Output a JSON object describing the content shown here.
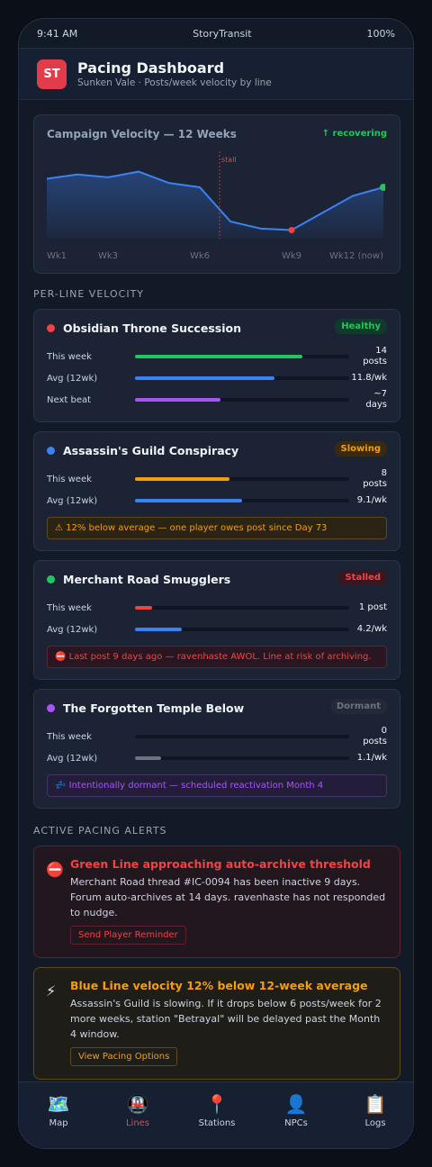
{
  "status_bar": {
    "time": "9:41 AM",
    "app_name": "StoryTransit",
    "battery": "100%"
  },
  "header": {
    "logo": "ST",
    "title": "Pacing Dashboard",
    "subtitle": "Sunken Vale · Posts/week velocity by line",
    "logo_color": "#e23b4a"
  },
  "velocity_chart": {
    "title": "Campaign Velocity — 12 Weeks",
    "status": "↑ recovering",
    "stall_label": "stall",
    "x_labels": [
      "Wk1",
      "Wk3",
      "Wk6",
      "Wk9",
      "Wk12 (now)"
    ]
  },
  "chart_data": {
    "type": "area",
    "title": "Campaign Velocity — 12 Weeks",
    "x": [
      "Wk1",
      "Wk2",
      "Wk3",
      "Wk4",
      "Wk5",
      "Wk6",
      "Wk7",
      "Wk8",
      "Wk9",
      "Wk10",
      "Wk11",
      "Wk12"
    ],
    "values": [
      42,
      45,
      43,
      47,
      39,
      36,
      12,
      7,
      6,
      18,
      30,
      36
    ],
    "ylim": [
      0,
      60
    ],
    "annotations": [
      {
        "x": "Wk7",
        "label": "stall"
      }
    ],
    "grid": false,
    "line_color": "#3b82f6",
    "low_point_color": "#ef4444",
    "current_point_color": "#22c55e"
  },
  "per_line_section_title": "PER-LINE VELOCITY",
  "lines": [
    {
      "name": "Obsidian Throne Succession",
      "color": "#ef4444",
      "badge": "Healthy",
      "badge_color": "#22c55e",
      "badge_bg": "#0f3a2c",
      "rows": [
        {
          "label": "This week",
          "value": "14\nposts",
          "fill": 0.78,
          "color": "#22c55e"
        },
        {
          "label": "Avg (12wk)",
          "value": "11.8/wk",
          "fill": 0.65,
          "color": "#3b82f6"
        },
        {
          "label": "Next beat",
          "value": "~7\ndays",
          "fill": 0.4,
          "color": "#a855f7"
        }
      ]
    },
    {
      "name": "Assassin's Guild Conspiracy",
      "color": "#3b82f6",
      "badge": "Slowing",
      "badge_color": "#f59e0b",
      "badge_bg": "#3a2a10",
      "rows": [
        {
          "label": "This week",
          "value": "8\nposts",
          "fill": 0.44,
          "color": "#f59e0b"
        },
        {
          "label": "Avg (12wk)",
          "value": "9.1/wk",
          "fill": 0.5,
          "color": "#3b82f6"
        }
      ],
      "note": "⚠ 12% below average — one player owes post since Day 73",
      "note_color": "#f59e0b",
      "note_bg": "#2a2414",
      "note_border": "#5c4a1c"
    },
    {
      "name": "Merchant Road Smugglers",
      "color": "#22c55e",
      "badge": "Stalled",
      "badge_color": "#ef4444",
      "badge_bg": "#3a1620",
      "rows": [
        {
          "label": "This week",
          "value": "1 post",
          "fill": 0.08,
          "color": "#ef4444"
        },
        {
          "label": "Avg (12wk)",
          "value": "4.2/wk",
          "fill": 0.22,
          "color": "#3b82f6"
        }
      ],
      "note": "⛔ Last post 9 days ago — ravenhaste AWOL. Line at risk of archiving.",
      "note_color": "#ef4444",
      "note_bg": "#2a1620",
      "note_border": "#5c2330"
    },
    {
      "name": "The Forgotten Temple Below",
      "color": "#a855f7",
      "badge": "Dormant",
      "badge_color": "#6b7280",
      "badge_bg": "#222a38",
      "rows": [
        {
          "label": "This week",
          "value": "0\nposts",
          "fill": 0.0,
          "color": "#6b7280"
        },
        {
          "label": "Avg (12wk)",
          "value": "1.1/wk",
          "fill": 0.12,
          "color": "#6b7280"
        }
      ],
      "note": "💤 Intentionally dormant — scheduled reactivation Month 4",
      "note_color": "#a855f7",
      "note_bg": "#241d3a",
      "note_border": "#3f3566"
    }
  ],
  "alerts_section_title": "ACTIVE PACING ALERTS",
  "alerts": [
    {
      "icon": "⛔",
      "icon_name": "no-entry-icon",
      "title": "Green Line approaching auto-archive threshold",
      "body": "Merchant Road thread #IC-0094 has been inactive 9 days. Forum auto-archives at 14 days. ravenhaste has not responded to nudge.",
      "button": "Send Player Reminder",
      "color": "#ef4444",
      "bg": "#22161f",
      "border": "#5c2330"
    },
    {
      "icon": "⚡",
      "icon_name": "lightning-icon",
      "title": "Blue Line velocity 12% below 12-week average",
      "body": "Assassin's Guild is slowing. If it drops below 6 posts/week for 2 more weeks, station \"Betrayal\" will be delayed past the Month 4 window.",
      "button": "View Pacing Options",
      "color": "#f59e0b",
      "bg": "#1f1d18",
      "border": "#5c4a1c"
    }
  ],
  "tabs": [
    {
      "icon": "🗺️",
      "label": "Map",
      "name": "map-icon",
      "active": false
    },
    {
      "icon": "🚇",
      "label": "Lines",
      "name": "metro-icon",
      "active": true
    },
    {
      "icon": "📍",
      "label": "Stations",
      "name": "pin-icon",
      "active": false
    },
    {
      "icon": "👤",
      "label": "NPCs",
      "name": "person-icon",
      "active": false
    },
    {
      "icon": "📋",
      "label": "Logs",
      "name": "clipboard-icon",
      "active": false
    }
  ]
}
